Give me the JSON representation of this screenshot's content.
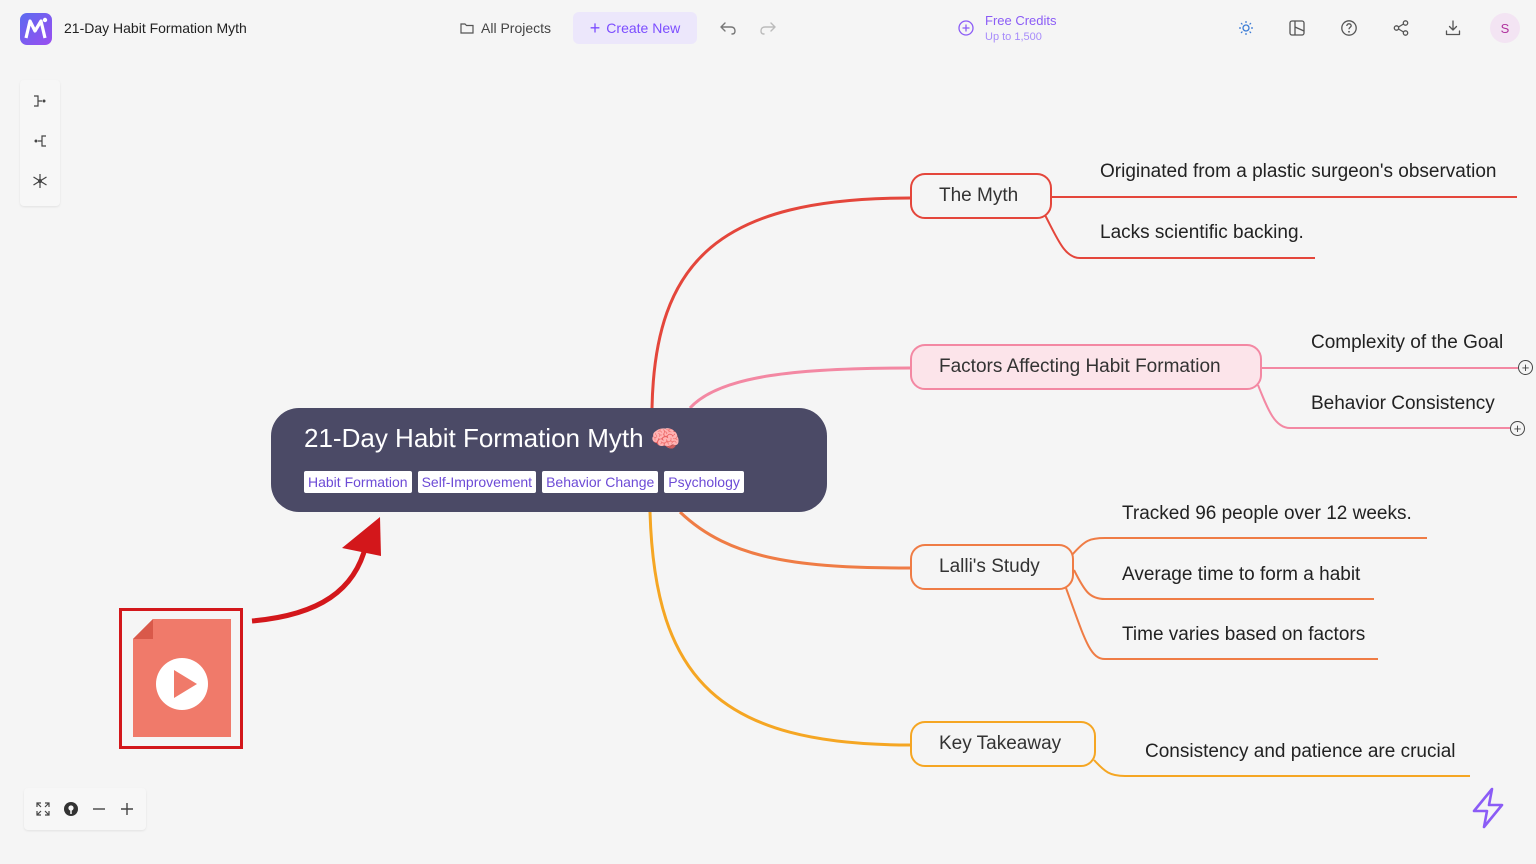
{
  "app": {
    "document_title": "21-Day Habit Formation Myth",
    "all_projects_label": "All Projects",
    "create_new_label": "Create New",
    "credits_title": "Free Credits",
    "credits_subtitle": "Up to 1,500",
    "avatar_initial": "S"
  },
  "mindmap": {
    "root": {
      "title": "21-Day Habit Formation Myth",
      "emoji": "🧠",
      "tags": [
        "Habit Formation",
        "Self-Improvement",
        "Behavior Change",
        "Psychology"
      ]
    },
    "branches": [
      {
        "label": "The Myth",
        "color": "#e4463b",
        "children": [
          "Originated from a plastic surgeon's observation",
          "Lacks scientific backing."
        ]
      },
      {
        "label": "Factors Affecting Habit Formation",
        "color": "#f388a3",
        "children": [
          "Complexity of the Goal",
          "Behavior Consistency"
        ]
      },
      {
        "label": "Lalli's Study",
        "color": "#ef7c45",
        "children": [
          "Tracked 96 people over 12 weeks.",
          "Average time to form a habit",
          "Time varies based on factors"
        ]
      },
      {
        "label": "Key Takeaway",
        "color": "#f5a623",
        "children": [
          "Consistency and patience are crucial"
        ]
      }
    ]
  },
  "colors": {
    "accent": "#7c4dff",
    "root_node_bg": "#4b4a66",
    "factors_fill": "#fce4ea",
    "annotation_red": "#d3171b",
    "video_icon": "#f07a6a"
  }
}
